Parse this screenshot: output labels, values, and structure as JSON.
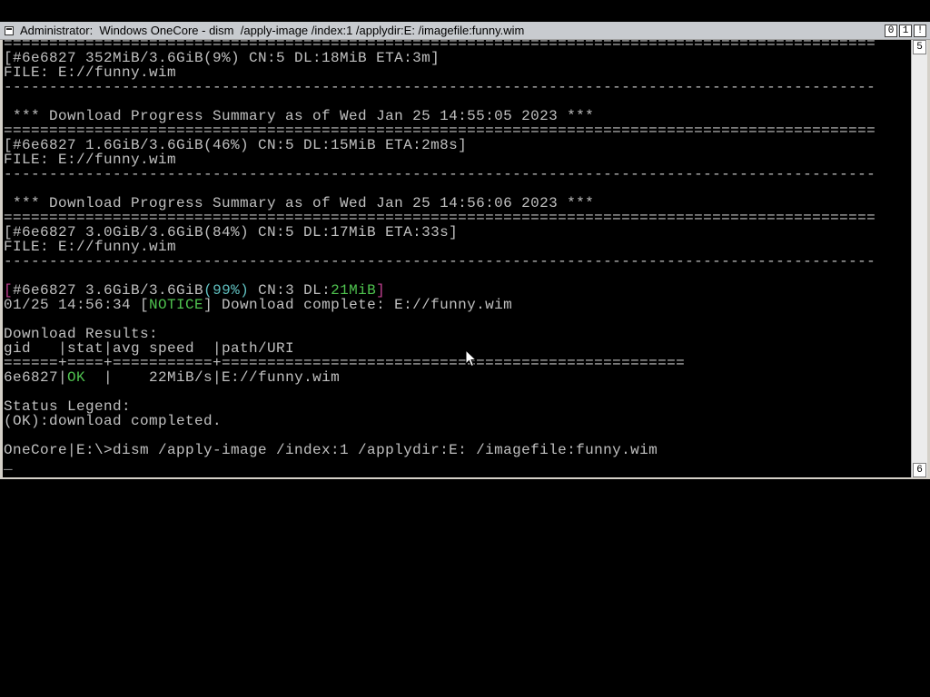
{
  "window": {
    "title": "Administrator:  Windows OneCore - dism  /apply-image /index:1 /applydir:E: /imagefile:funny.wim",
    "buttons": [
      "0",
      "1",
      "!"
    ],
    "scroll_up_label": "5",
    "scroll_down_label": "6"
  },
  "console": {
    "lines": [
      [
        {
          "t": "================================================================================================"
        }
      ],
      [
        {
          "t": "[#6e6827 352MiB/3.6GiB(9%) CN:5 DL:18MiB ETA:3m]"
        }
      ],
      [
        {
          "t": "FILE: E://funny.wim"
        }
      ],
      [
        {
          "t": "------------------------------------------------------------------------------------------------"
        }
      ],
      [
        {
          "t": ""
        }
      ],
      [
        {
          "t": " *** Download Progress Summary as of Wed Jan 25 14:55:05 2023 ***"
        }
      ],
      [
        {
          "t": "================================================================================================"
        }
      ],
      [
        {
          "t": "[#6e6827 1.6GiB/3.6GiB(46%) CN:5 DL:15MiB ETA:2m8s]"
        }
      ],
      [
        {
          "t": "FILE: E://funny.wim"
        }
      ],
      [
        {
          "t": "------------------------------------------------------------------------------------------------"
        }
      ],
      [
        {
          "t": ""
        }
      ],
      [
        {
          "t": " *** Download Progress Summary as of Wed Jan 25 14:56:06 2023 ***"
        }
      ],
      [
        {
          "t": "================================================================================================"
        }
      ],
      [
        {
          "t": "[#6e6827 3.0GiB/3.6GiB(84%) CN:5 DL:17MiB ETA:33s]"
        }
      ],
      [
        {
          "t": "FILE: E://funny.wim"
        }
      ],
      [
        {
          "t": "------------------------------------------------------------------------------------------------"
        }
      ],
      [
        {
          "t": ""
        }
      ],
      [
        {
          "t": "[",
          "c": "magenta"
        },
        {
          "t": "#6e6827 3.6GiB/3.6GiB"
        },
        {
          "t": "(99%)",
          "c": "cyan"
        },
        {
          "t": " CN:3 DL:"
        },
        {
          "t": "21MiB",
          "c": "green"
        },
        {
          "t": "]",
          "c": "magenta"
        }
      ],
      [
        {
          "t": "01/25 14:56:34 ["
        },
        {
          "t": "NOTICE",
          "c": "green"
        },
        {
          "t": "] Download complete: E://funny.wim"
        }
      ],
      [
        {
          "t": ""
        }
      ],
      [
        {
          "t": "Download Results:"
        }
      ],
      [
        {
          "t": "gid   |stat|avg speed  |path/URI"
        }
      ],
      [
        {
          "t": "======+====+===========+==================================================="
        }
      ],
      [
        {
          "t": "6e6827|"
        },
        {
          "t": "OK",
          "c": "green"
        },
        {
          "t": "  |    22MiB/s|E://funny.wim"
        }
      ],
      [
        {
          "t": ""
        }
      ],
      [
        {
          "t": "Status Legend:"
        }
      ],
      [
        {
          "t": "(OK):download completed."
        }
      ],
      [
        {
          "t": ""
        }
      ],
      [
        {
          "t": "OneCore|E:\\>dism /apply-image /index:1 /applydir:E: /imagefile:funny.wim"
        }
      ],
      [
        {
          "t": "_"
        }
      ]
    ]
  },
  "colors": {
    "console_bg": "#000000",
    "console_fg": "#c0c0c0",
    "magenta": "#c0408f",
    "green": "#4fc34f",
    "cyan": "#60c0c0",
    "titlebar_bg": "#c8cbcf"
  },
  "icons": {
    "window_icon": "console-window-icon",
    "cursor": "mouse-pointer-icon"
  }
}
